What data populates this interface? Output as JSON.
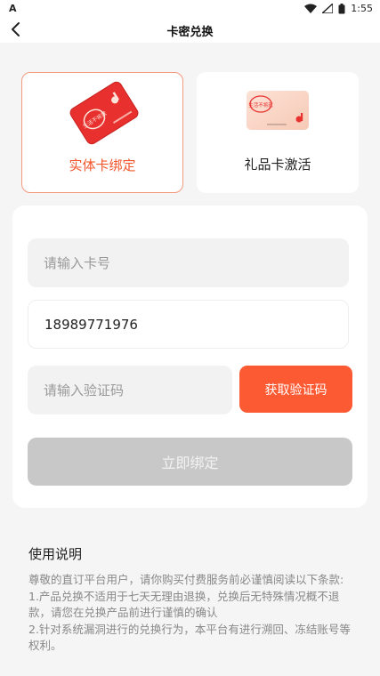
{
  "status_bar": {
    "left_icon": "notification-a-icon",
    "time": "1:55"
  },
  "header": {
    "title": "卡密兑换"
  },
  "card_types": [
    {
      "label": "实体卡绑定",
      "selected": true
    },
    {
      "label": "礼品卡激活",
      "selected": false
    }
  ],
  "card_art_text": "生活不将就",
  "form": {
    "card_number_placeholder": "请输入卡号",
    "phone_value": "18989771976",
    "code_placeholder": "请输入验证码",
    "get_code_label": "获取验证码",
    "bind_label": "立即绑定"
  },
  "instructions": {
    "title": "使用说明",
    "paragraphs": [
      "尊敬的直订平台用户，请你购买付费服务前必谨慎阅读以下条款:",
      "1.产品兑换不适用于七天无理由退换，兑换后无特殊情况概不退款，请您在兑换产品前进行谨慎的确认",
      "2.针对系统漏洞进行的兑换行为，本平台有进行溯回、冻结账号等权利。"
    ]
  },
  "colors": {
    "accent": "#fb5a33",
    "selected_text": "#f1552b",
    "disabled_button": "#c8c8c8"
  }
}
